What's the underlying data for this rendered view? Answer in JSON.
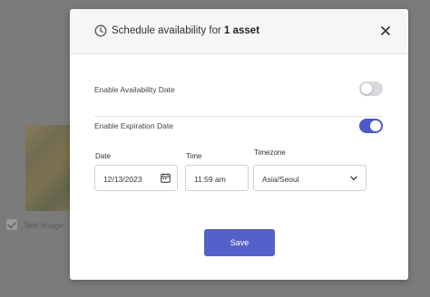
{
  "background": {
    "asset_label": "Test Image"
  },
  "modal": {
    "title_prefix": "Schedule availability for",
    "title_bold": "1 asset",
    "icons": {
      "header": "clock-icon",
      "close": "close-icon",
      "date": "calendar-icon",
      "timezone": "chevron-down-icon"
    },
    "availability": {
      "label": "Enable Availability Date",
      "enabled": false
    },
    "expiration": {
      "label": "Enable Expiration Date",
      "enabled": true
    },
    "fields": {
      "date": {
        "label": "Date",
        "value": "12/13/2023"
      },
      "time": {
        "label": "Time",
        "value": "11:59 am"
      },
      "timezone": {
        "label": "Timezone",
        "value": "Asia/Seoul"
      }
    },
    "save_label": "Save",
    "colors": {
      "accent": "#5461c8",
      "toggle_on": "#4e5ac8",
      "toggle_off": "#d8d9dc",
      "overlay": "#7b7b7b"
    }
  }
}
